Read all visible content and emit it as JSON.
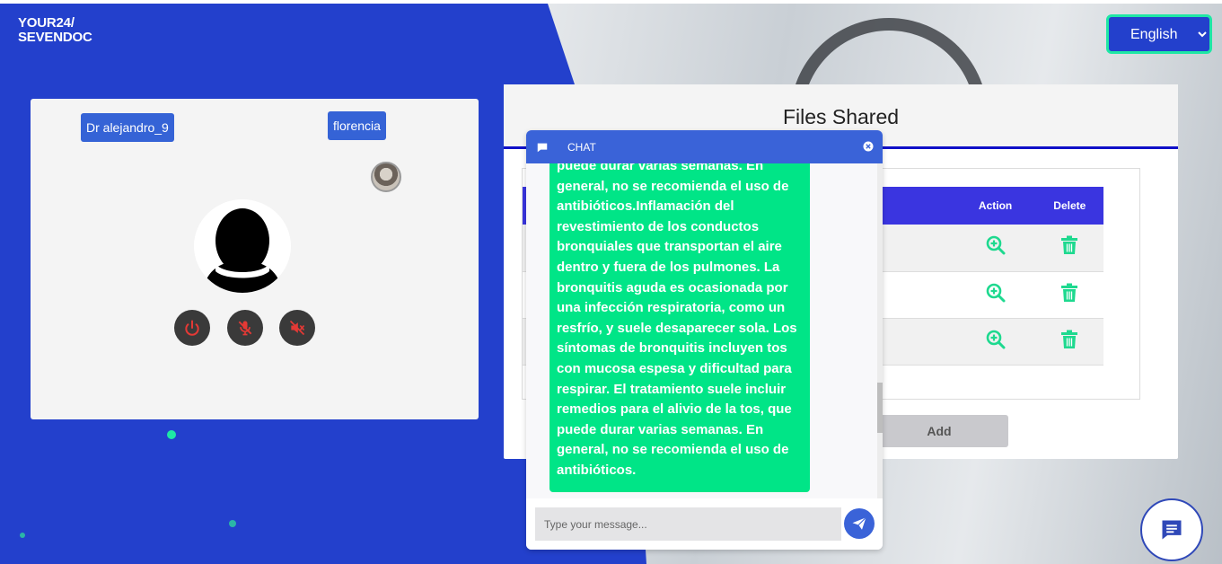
{
  "brand": {
    "logo_line1": "YOUR24/",
    "logo_line2": "SEVENDOC"
  },
  "language": {
    "selected": "English",
    "options": [
      "English"
    ]
  },
  "video": {
    "doctor_name": "Dr alejandro_9",
    "patient_name": "florencia",
    "controls": [
      "power-icon",
      "mic-off-icon",
      "speaker-off-icon"
    ]
  },
  "files": {
    "title": "Files Shared",
    "columns": {
      "action": "Action",
      "delete": "Delete"
    },
    "rows": [
      {
        "action_icon": "zoom-in-icon",
        "delete_icon": "trash-icon"
      },
      {
        "action_icon": "zoom-in-icon",
        "delete_icon": "trash-icon"
      },
      {
        "action_icon": "zoom-in-icon",
        "delete_icon": "trash-icon"
      }
    ],
    "add_label": "Add"
  },
  "chat": {
    "title": "CHAT",
    "message": "puede durar varias semanas. En general, no se recomienda el uso de antibióticos.Inflamación del revestimiento de los conductos bronquiales que transportan el aire dentro y fuera de los pulmones. La bronquitis aguda es ocasionada por una infección respiratoria, como un resfrío, y suele desaparecer sola. Los síntomas de bronquitis incluyen tos con mucosa espesa y dificultad para respirar. El tratamiento suele incluir remedios para el alivio de la tos, que puede durar varias semanas. En general, no se recomienda el uso de antibióticos.",
    "input_placeholder": "Type your message..."
  },
  "colors": {
    "primary_blue": "#2340cc",
    "accent_green": "#00e587",
    "header_blue": "#3a63d8",
    "table_header": "#3a35e0"
  }
}
